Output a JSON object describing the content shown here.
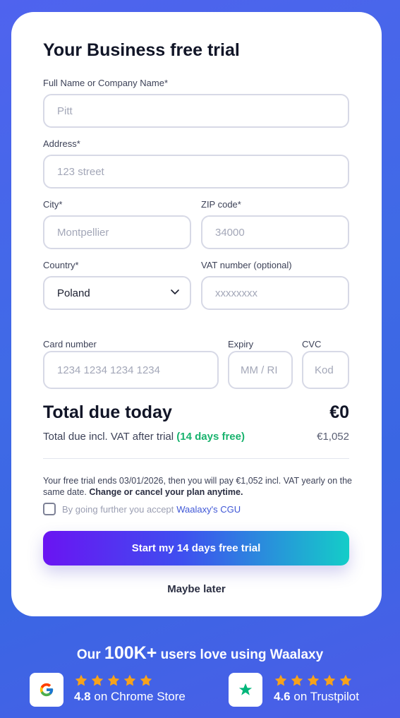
{
  "form": {
    "title": "Your Business free trial",
    "name": {
      "label": "Full Name or Company Name*",
      "placeholder": "Pitt"
    },
    "address": {
      "label": "Address*",
      "placeholder": "123 street"
    },
    "city": {
      "label": "City*",
      "placeholder": "Montpellier"
    },
    "zip": {
      "label": "ZIP code*",
      "placeholder": "34000"
    },
    "country": {
      "label": "Country*",
      "value": "Poland"
    },
    "vat": {
      "label": "VAT number (optional)",
      "placeholder": "xxxxxxxx"
    },
    "card_number": {
      "label": "Card number",
      "placeholder": "1234 1234 1234 1234"
    },
    "expiry": {
      "label": "Expiry",
      "placeholder": "MM / RI"
    },
    "cvc": {
      "label": "CVC",
      "placeholder": "Kod"
    }
  },
  "summary": {
    "total_label": "Total due today",
    "total_value": "€0",
    "vat_label": "Total due incl. VAT after trial",
    "vat_free": "(14 days free)",
    "vat_value": "€1,052",
    "notice_text": "Your free trial ends 03/01/2026, then you will pay €1,052 incl. VAT yearly on the same date.",
    "notice_bold": "Change or cancel your plan anytime.",
    "consent_text": "By going further you accept",
    "consent_link": "Waalaxy's CGU"
  },
  "actions": {
    "start_label": "Start my 14 days free trial",
    "maybe_label": "Maybe later"
  },
  "promo": {
    "prefix": "Our",
    "count": "100K+",
    "suffix": "users love using Waalaxy",
    "chrome_score": "4.8",
    "chrome_text": "on Chrome Store",
    "trust_score": "4.6",
    "trust_text": "on Trustpilot",
    "star_color": "#f7a21b",
    "trustpilot_color": "#00b67a"
  }
}
